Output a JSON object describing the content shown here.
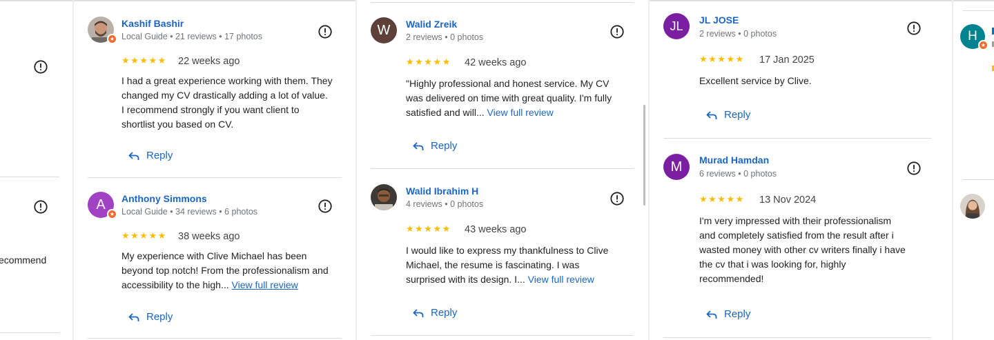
{
  "panel0": {
    "partial_text": "ecommend"
  },
  "panel1": {
    "reviews": [
      {
        "name": "Kashif Bashir",
        "meta": "Local Guide • 21 reviews • 17 photos",
        "rating": 5,
        "stars": "★★★★★",
        "date": "22 weeks ago",
        "lines": [
          "I had a great experience working with them. They",
          "changed my CV drastically adding a lot of value.",
          "I recommend strongly if you want client to",
          "shortlist you based on CV."
        ],
        "reply": "Reply"
      },
      {
        "name": "Anthony Simmons",
        "avatar_letter": "A",
        "meta": "Local Guide • 34 reviews • 6 photos",
        "rating": 5,
        "stars": "★★★★★",
        "date": "38 weeks ago",
        "lines": [
          "My experience with Clive Michael has been",
          "beyond top notch! From the professionalism and",
          "accessibility to the high..."
        ],
        "more": "View full review",
        "reply": "Reply"
      }
    ]
  },
  "panel2": {
    "reviews": [
      {
        "name": "Walid Zreik",
        "avatar_letter": "W",
        "meta": "2 reviews • 0 photos",
        "rating": 5,
        "stars": "★★★★★",
        "date": "42 weeks ago",
        "lines": [
          "\"Highly professional and honest service. My CV",
          "was delivered on time with great quality. I'm fully",
          "satisfied and will..."
        ],
        "more": "View full review",
        "reply": "Reply"
      },
      {
        "name": "Walid Ibrahim H",
        "meta": "4 reviews • 0 photos",
        "rating": 5,
        "stars": "★★★★★",
        "date": "43 weeks ago",
        "lines": [
          "I would like to express my thankfulness to Clive",
          "Michael, the resume is fascinating. I was",
          "surprised with its design. I..."
        ],
        "more": "View full review",
        "reply": "Reply"
      }
    ]
  },
  "panel3": {
    "reviews": [
      {
        "name": "JL JOSE",
        "avatar_letter": "JL",
        "meta": "2 reviews • 0 photos",
        "rating": 5,
        "stars": "★★★★★",
        "date": "17 Jan 2025",
        "lines": [
          "Excellent service by Clive."
        ],
        "reply": "Reply"
      },
      {
        "name": "Murad Hamdan",
        "avatar_letter": "M",
        "meta": "6 reviews • 0 photos",
        "rating": 5,
        "stars": "★★★★★",
        "date": "13 Nov 2024",
        "lines": [
          "I'm very impressed with their professionalism",
          "and completely satisfied from the result after i",
          "wasted money with other cv writers finally i have",
          "the cv that i was looking for, highly",
          "recommended!"
        ],
        "reply": "Reply"
      }
    ]
  },
  "panel4": {
    "avatar_letter": "H"
  },
  "colors": {
    "link": "#1a66c2",
    "star": "#fbbc04",
    "meta": "#70757a",
    "divider": "#dadce0",
    "avatar_anthony": "#a142c4",
    "avatar_walid": "#5d4037",
    "avatar_jl": "#7b1fa2",
    "avatar_murad": "#7b1fa2",
    "avatar_h": "#00838f",
    "local_guide_badge": "#ef6c2e"
  }
}
